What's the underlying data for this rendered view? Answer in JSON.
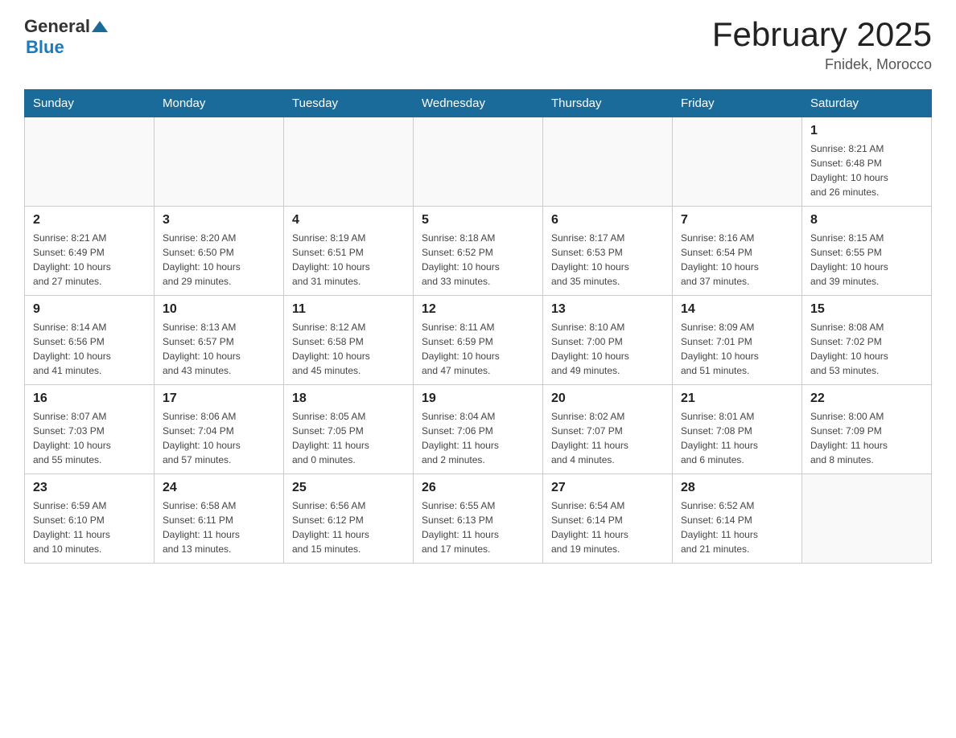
{
  "header": {
    "logo_general": "General",
    "logo_blue": "Blue",
    "title": "February 2025",
    "subtitle": "Fnidek, Morocco"
  },
  "days_of_week": [
    "Sunday",
    "Monday",
    "Tuesday",
    "Wednesday",
    "Thursday",
    "Friday",
    "Saturday"
  ],
  "weeks": [
    [
      {
        "day": "",
        "info": ""
      },
      {
        "day": "",
        "info": ""
      },
      {
        "day": "",
        "info": ""
      },
      {
        "day": "",
        "info": ""
      },
      {
        "day": "",
        "info": ""
      },
      {
        "day": "",
        "info": ""
      },
      {
        "day": "1",
        "info": "Sunrise: 8:21 AM\nSunset: 6:48 PM\nDaylight: 10 hours\nand 26 minutes."
      }
    ],
    [
      {
        "day": "2",
        "info": "Sunrise: 8:21 AM\nSunset: 6:49 PM\nDaylight: 10 hours\nand 27 minutes."
      },
      {
        "day": "3",
        "info": "Sunrise: 8:20 AM\nSunset: 6:50 PM\nDaylight: 10 hours\nand 29 minutes."
      },
      {
        "day": "4",
        "info": "Sunrise: 8:19 AM\nSunset: 6:51 PM\nDaylight: 10 hours\nand 31 minutes."
      },
      {
        "day": "5",
        "info": "Sunrise: 8:18 AM\nSunset: 6:52 PM\nDaylight: 10 hours\nand 33 minutes."
      },
      {
        "day": "6",
        "info": "Sunrise: 8:17 AM\nSunset: 6:53 PM\nDaylight: 10 hours\nand 35 minutes."
      },
      {
        "day": "7",
        "info": "Sunrise: 8:16 AM\nSunset: 6:54 PM\nDaylight: 10 hours\nand 37 minutes."
      },
      {
        "day": "8",
        "info": "Sunrise: 8:15 AM\nSunset: 6:55 PM\nDaylight: 10 hours\nand 39 minutes."
      }
    ],
    [
      {
        "day": "9",
        "info": "Sunrise: 8:14 AM\nSunset: 6:56 PM\nDaylight: 10 hours\nand 41 minutes."
      },
      {
        "day": "10",
        "info": "Sunrise: 8:13 AM\nSunset: 6:57 PM\nDaylight: 10 hours\nand 43 minutes."
      },
      {
        "day": "11",
        "info": "Sunrise: 8:12 AM\nSunset: 6:58 PM\nDaylight: 10 hours\nand 45 minutes."
      },
      {
        "day": "12",
        "info": "Sunrise: 8:11 AM\nSunset: 6:59 PM\nDaylight: 10 hours\nand 47 minutes."
      },
      {
        "day": "13",
        "info": "Sunrise: 8:10 AM\nSunset: 7:00 PM\nDaylight: 10 hours\nand 49 minutes."
      },
      {
        "day": "14",
        "info": "Sunrise: 8:09 AM\nSunset: 7:01 PM\nDaylight: 10 hours\nand 51 minutes."
      },
      {
        "day": "15",
        "info": "Sunrise: 8:08 AM\nSunset: 7:02 PM\nDaylight: 10 hours\nand 53 minutes."
      }
    ],
    [
      {
        "day": "16",
        "info": "Sunrise: 8:07 AM\nSunset: 7:03 PM\nDaylight: 10 hours\nand 55 minutes."
      },
      {
        "day": "17",
        "info": "Sunrise: 8:06 AM\nSunset: 7:04 PM\nDaylight: 10 hours\nand 57 minutes."
      },
      {
        "day": "18",
        "info": "Sunrise: 8:05 AM\nSunset: 7:05 PM\nDaylight: 11 hours\nand 0 minutes."
      },
      {
        "day": "19",
        "info": "Sunrise: 8:04 AM\nSunset: 7:06 PM\nDaylight: 11 hours\nand 2 minutes."
      },
      {
        "day": "20",
        "info": "Sunrise: 8:02 AM\nSunset: 7:07 PM\nDaylight: 11 hours\nand 4 minutes."
      },
      {
        "day": "21",
        "info": "Sunrise: 8:01 AM\nSunset: 7:08 PM\nDaylight: 11 hours\nand 6 minutes."
      },
      {
        "day": "22",
        "info": "Sunrise: 8:00 AM\nSunset: 7:09 PM\nDaylight: 11 hours\nand 8 minutes."
      }
    ],
    [
      {
        "day": "23",
        "info": "Sunrise: 6:59 AM\nSunset: 6:10 PM\nDaylight: 11 hours\nand 10 minutes."
      },
      {
        "day": "24",
        "info": "Sunrise: 6:58 AM\nSunset: 6:11 PM\nDaylight: 11 hours\nand 13 minutes."
      },
      {
        "day": "25",
        "info": "Sunrise: 6:56 AM\nSunset: 6:12 PM\nDaylight: 11 hours\nand 15 minutes."
      },
      {
        "day": "26",
        "info": "Sunrise: 6:55 AM\nSunset: 6:13 PM\nDaylight: 11 hours\nand 17 minutes."
      },
      {
        "day": "27",
        "info": "Sunrise: 6:54 AM\nSunset: 6:14 PM\nDaylight: 11 hours\nand 19 minutes."
      },
      {
        "day": "28",
        "info": "Sunrise: 6:52 AM\nSunset: 6:14 PM\nDaylight: 11 hours\nand 21 minutes."
      },
      {
        "day": "",
        "info": ""
      }
    ]
  ]
}
